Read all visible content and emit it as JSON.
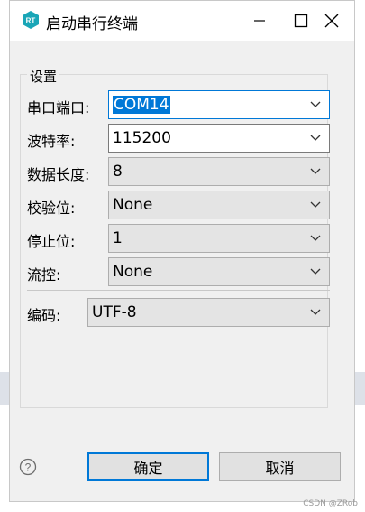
{
  "window": {
    "title": "启动串行终端",
    "app_icon_text": "RT"
  },
  "group": {
    "legend": "设置"
  },
  "fields": [
    {
      "label": "串口端口:",
      "value": "COM14"
    },
    {
      "label": "波特率:",
      "value": "115200"
    },
    {
      "label": "数据长度:",
      "value": "8"
    },
    {
      "label": "校验位:",
      "value": "None"
    },
    {
      "label": "停止位:",
      "value": "1"
    },
    {
      "label": "流控:",
      "value": "None"
    },
    {
      "label": "编码:",
      "value": "UTF-8"
    }
  ],
  "buttons": {
    "ok": "确定",
    "cancel": "取消"
  },
  "watermark": "CSDN @ZRob",
  "colors": {
    "accent": "#0078d7",
    "icon_teal": "#1aa6b7"
  }
}
